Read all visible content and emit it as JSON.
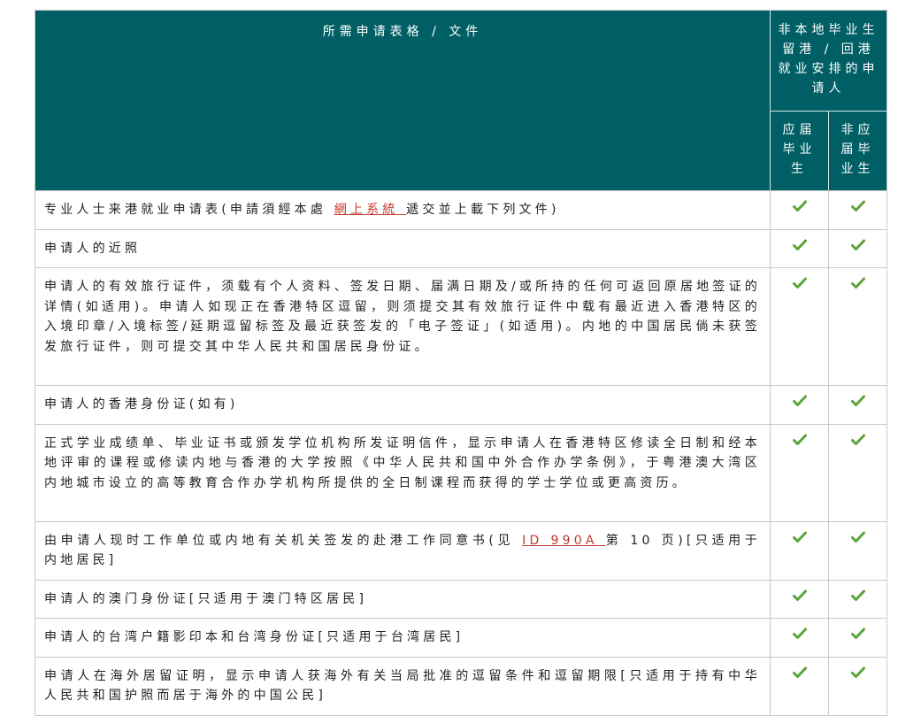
{
  "header": {
    "documents": "所需申请表格 / 文件",
    "group": "非本地毕业生留港 / 回港就业安排的申请人",
    "col_current": "应届毕业生",
    "col_noncurrent": "非应届毕业生"
  },
  "rows": [
    {
      "pre": "专业人士来港就业申请表(申請須經本處 ",
      "link": "網上系統 ",
      "post": "遞交並上載下列文件)"
    },
    {
      "text": "申请人的近照"
    },
    {
      "text": "申请人的有效旅行证件，须载有个人资料、签发日期、届满日期及/或所持的任何可返回原居地签证的详情(如适用)。申请人如现正在香港特区逗留，则须提交其有效旅行证件中载有最近进入香港特区的入境印章/入境标签/延期逗留标签及最近获签发的「电子签证」(如适用)。内地的中国居民倘未获签发旅行证件，则可提交其中华人民共和国居民身份证。"
    },
    {
      "text": "申请人的香港身份证(如有)"
    },
    {
      "text": "正式学业成绩单、毕业证书或颁发学位机构所发证明信件，显示申请人在香港特区修读全日制和经本地评审的课程或修读内地与香港的大学按照《中华人民共和国中外合作办学条例》，于粤港澳大湾区内地城市设立的高等教育合作办学机构所提供的全日制课程而获得的学士学位或更高资历。"
    },
    {
      "pre": "由申请人现时工作单位或内地有关机关签发的赴港工作同意书(见 ",
      "link": "ID 990A ",
      "post": "第 10 页)[只适用于内地居民]"
    },
    {
      "text": "申请人的澳门身份证[只适用于澳门特区居民]"
    },
    {
      "text": "申请人的台湾户籍影印本和台湾身份证[只适用于台湾居民]"
    },
    {
      "text": "申请人在海外居留证明，显示申请人获海外有关当局批准的逗留条件和逗留期限[只适用于持有中华人民共和国护照而居于海外的中国公民]"
    }
  ],
  "colors": {
    "header_bg": "#005f65",
    "tick": "#5aa33a",
    "link": "#c0392b"
  },
  "icons": {
    "tick": "check-icon"
  }
}
